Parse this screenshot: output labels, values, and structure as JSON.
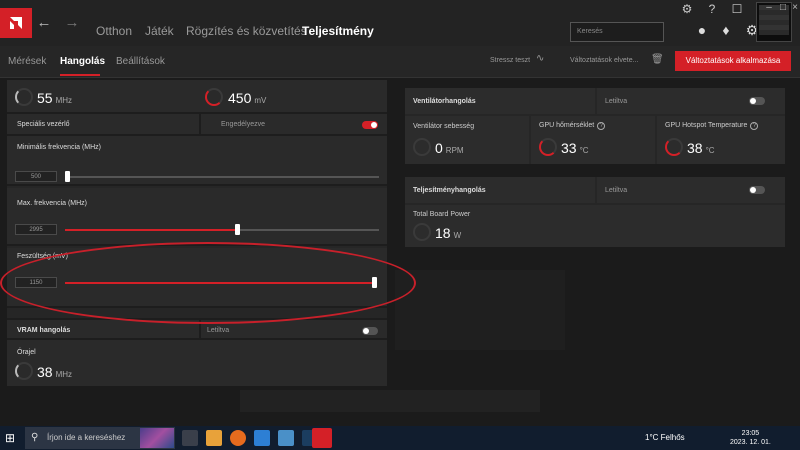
{
  "nav": {
    "tabs": [
      {
        "label": "Otthon"
      },
      {
        "label": "Játék"
      },
      {
        "label": "Rögzítés és közvetítés"
      },
      {
        "label": "Teljesítmény"
      }
    ],
    "search_placeholder": "Keresés",
    "active_tab": "Teljesítmény"
  },
  "subnav": {
    "tabs": [
      {
        "label": "Mérések"
      },
      {
        "label": "Hangolás"
      },
      {
        "label": "Beállítások"
      }
    ],
    "stress_test": "Stressz teszt",
    "discard": "Változtatások elvete...",
    "apply": "Változtatások alkalmazása"
  },
  "left": {
    "top_values": {
      "freq": "55",
      "freq_unit": "MHz",
      "volt": "450",
      "volt_unit": "mV"
    },
    "special_ctrl": {
      "label": "Speciális vezérlő",
      "state": "Engedélyezve"
    },
    "min_freq": {
      "label": "Minimális frekvencia (MHz)",
      "value": "500",
      "fraction": 0.0
    },
    "max_freq": {
      "label": "Max. frekvencia (MHz)",
      "value": "2995",
      "fraction": 0.55
    },
    "voltage": {
      "label": "Feszültség (mV)",
      "value": "1150",
      "fraction": 1.0
    },
    "vram": {
      "label": "VRAM hangolás",
      "state": "Letiltva"
    },
    "clock": {
      "label": "Órajel",
      "value": "38",
      "unit": "MHz"
    }
  },
  "fan": {
    "title": "Ventilátorhangolás",
    "state": "Letiltva",
    "speed_label": "Ventilátor sebesség",
    "speed_value": "0",
    "speed_unit": "RPM",
    "gpu_temp_label": "GPU hőmérséklet",
    "gpu_temp_value": "33",
    "gpu_temp_unit": "°C",
    "hotspot_label": "GPU Hotspot Temperature",
    "hotspot_value": "38",
    "hotspot_unit": "°C"
  },
  "power": {
    "title": "Teljesítményhangolás",
    "state": "Letiltva",
    "tbp_label": "Total Board Power",
    "tbp_value": "18",
    "tbp_unit": "W"
  },
  "taskbar": {
    "search_placeholder": "Írjon ide a kereséshez",
    "weather": "1°C  Felhős",
    "time": "23:05",
    "date": "2023. 12. 01."
  },
  "colors": {
    "accent": "#d42027"
  }
}
